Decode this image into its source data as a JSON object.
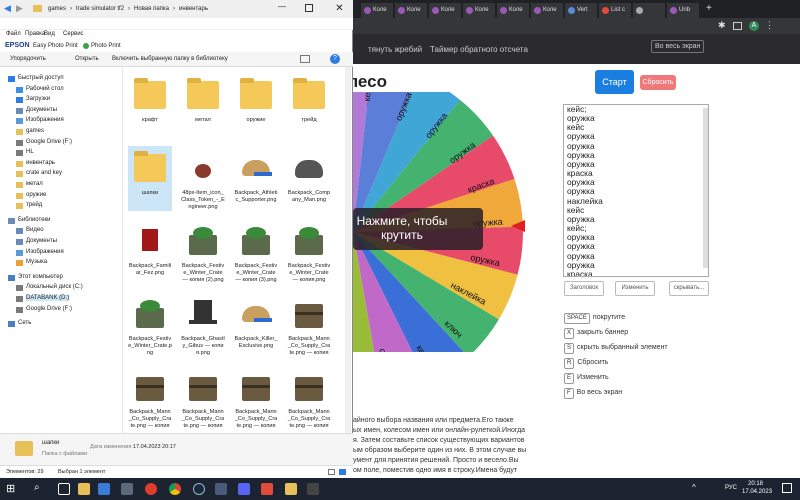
{
  "explorer": {
    "breadcrumb": [
      "games",
      "trade simulator tf2",
      "Новая папка",
      "инвентарь"
    ],
    "menu": [
      "Файл",
      "Правка",
      "Вид",
      "Сервис"
    ],
    "quick": {
      "brand": "EPSON",
      "app1": "Easy Photo Print",
      "app2": "Photo Print"
    },
    "toolbar": {
      "organize": "Упорядочить",
      "open": "Открыть",
      "include": "Включить выбранную папку в библиотеку"
    },
    "nav": [
      {
        "label": "Быстрый доступ",
        "indent": 0,
        "color": "#2d7be5"
      },
      {
        "label": "Рабочий стол",
        "indent": 1,
        "color": "#3d8ee6"
      },
      {
        "label": "Загрузки",
        "indent": 1,
        "color": "#2d7be5"
      },
      {
        "label": "Документы",
        "indent": 1,
        "color": "#6a8bb5"
      },
      {
        "label": "Изображения",
        "indent": 1,
        "color": "#5b9bd5"
      },
      {
        "label": "games",
        "indent": 1,
        "color": "#e8c05a"
      },
      {
        "label": "Google Drive (F:)",
        "indent": 1,
        "color": "#7a7a7a"
      },
      {
        "label": "HL",
        "indent": 1,
        "color": "#7a7a7a"
      },
      {
        "label": "инвентарь",
        "indent": 1,
        "color": "#e8c05a"
      },
      {
        "label": "crate and key",
        "indent": 1,
        "color": "#e8c05a"
      },
      {
        "label": "метал",
        "indent": 1,
        "color": "#e8c05a"
      },
      {
        "label": "оружие",
        "indent": 1,
        "color": "#e8c05a"
      },
      {
        "label": "трейд",
        "indent": 1,
        "color": "#e8c05a"
      },
      {
        "label": "Библиотеки",
        "indent": 0,
        "color": "#6a8bb5"
      },
      {
        "label": "Видео",
        "indent": 1,
        "color": "#6a8bb5"
      },
      {
        "label": "Документы",
        "indent": 1,
        "color": "#6a8bb5"
      },
      {
        "label": "Изображения",
        "indent": 1,
        "color": "#5b9bd5"
      },
      {
        "label": "Музыка",
        "indent": 1,
        "color": "#e8a03a"
      },
      {
        "label": "Этот компьютер",
        "indent": 0,
        "color": "#4a7fc4"
      },
      {
        "label": "Локальный диск (C:)",
        "indent": 1,
        "color": "#7a7a7a"
      },
      {
        "label": "DATABANK (D:)",
        "indent": 1,
        "color": "#7a7a7a"
      },
      {
        "label": "Google Drive (F:)",
        "indent": 1,
        "color": "#7a7a7a"
      },
      {
        "label": "Сеть",
        "indent": 0,
        "color": "#4a7fc4"
      }
    ],
    "files": [
      {
        "name": "крафт",
        "kind": "folder"
      },
      {
        "name": "метал",
        "kind": "folder"
      },
      {
        "name": "оружие",
        "kind": "folder"
      },
      {
        "name": "трейд",
        "kind": "folder"
      },
      {
        "name": "шапки",
        "kind": "folder"
      },
      {
        "name": "48px-Item_icon_Class_Token_-_Engineer.png",
        "kind": "token"
      },
      {
        "name": "Backpack_Athletic_Supporter.png",
        "kind": "cap"
      },
      {
        "name": "Backpack_Company_Man.png",
        "kind": "hat"
      },
      {
        "name": "Backpack_Familiar_Fez.png",
        "kind": "fez"
      },
      {
        "name": "Backpack_Festive_Winter_Crate — копия (2).png",
        "kind": "crate"
      },
      {
        "name": "Backpack_Festive_Winter_Crate — копия (3).png",
        "kind": "crate"
      },
      {
        "name": "Backpack_Festive_Winter_Crate — копия.png",
        "kind": "crate"
      },
      {
        "name": "Backpack_Festive_Winter_Crate.png",
        "kind": "crate"
      },
      {
        "name": "Backpack_Ghastly_Gibus — копия.png",
        "kind": "tophat"
      },
      {
        "name": "Backpack_Killer_Exclusive.png",
        "kind": "cap"
      },
      {
        "name": "Backpack_Mann_Co_Supply_Crate.png — копия — копия (2)",
        "kind": "box"
      },
      {
        "name": "Backpack_Mann_Co_Supply_Crate.png — копия — коп",
        "kind": "box"
      },
      {
        "name": "Backpack_Mann_Co_Supply_Crate.png — копия — коп",
        "kind": "box"
      },
      {
        "name": "Backpack_Mann_Co_Supply_Crate.png — копия — коп",
        "kind": "box"
      },
      {
        "name": "Backpack_Mann_Co_Supply_Crate.png — копия (2)",
        "kind": "box"
      }
    ],
    "details": {
      "name": "шапки",
      "date_label": "Дата изменения:",
      "date": "17.04.2023 20:17",
      "type": "Папка с файлами"
    },
    "status": {
      "count": "Элементов: 29",
      "selected": "Выбран 1 элемент"
    }
  },
  "browser": {
    "tabs": [
      {
        "label": "Коле",
        "color": "#9b59b6"
      },
      {
        "label": "Коле",
        "color": "#9b59b6"
      },
      {
        "label": "Коле",
        "color": "#9b59b6"
      },
      {
        "label": "Коле",
        "color": "#9b59b6"
      },
      {
        "label": "Коле",
        "color": "#9b59b6"
      },
      {
        "label": "Коле",
        "color": "#9b59b6"
      },
      {
        "label": "Vert",
        "color": "#5a8ad8"
      },
      {
        "label": "List c",
        "color": "#e24a3b"
      },
      {
        "label": "",
        "color": "#aaa"
      },
      {
        "label": "Unb",
        "color": "#9b59b6"
      }
    ],
    "toolbar_avatar": "A",
    "nav_links": [
      "тянуть жребий",
      "Таймер обратного отсчета"
    ],
    "fullscreen_btn": "Во весь экран",
    "title": "Колесо фортуны",
    "start": "Старт",
    "reset": "Сбросить",
    "wheel_center": "Нажмите, чтобы крутить",
    "wheel_labels": [
      {
        "text": "кейс",
        "deg": 84
      },
      {
        "text": "оружка",
        "deg": 68
      },
      {
        "text": "оружка",
        "deg": 52
      },
      {
        "text": "оружка",
        "deg": 36
      },
      {
        "text": "краска",
        "deg": 20
      },
      {
        "text": "оружка",
        "deg": 4
      },
      {
        "text": "оружка",
        "deg": -12
      },
      {
        "text": "наклейка",
        "deg": -28
      },
      {
        "text": "ключ",
        "deg": -44
      },
      {
        "text": "кейс",
        "deg": -60
      },
      {
        "text": "оружка",
        "deg": -76
      },
      {
        "text": "кейс",
        "deg": 100
      },
      {
        "text": "оружка",
        "deg": 116
      }
    ],
    "list_items": [
      "кейс;",
      "оружка",
      "кейс",
      "оружка",
      "оружка",
      "оружка",
      "оружка",
      "краска",
      "оружка",
      "оружка",
      "наклейка",
      "кейс",
      "оружка",
      "кейс;",
      "оружка",
      "оружка",
      "оружка",
      "оружка",
      "краска"
    ],
    "side_buttons": {
      "save": "Заголовок",
      "change": "Изменить",
      "hide": "скрывать..."
    },
    "shortcuts": [
      {
        "key": "SPACE",
        "label": "покрутите"
      },
      {
        "key": "X",
        "label": "закрыть баннер"
      },
      {
        "key": "S",
        "label": "скрыть выбранный элемент"
      },
      {
        "key": "R",
        "label": "Сбросить"
      },
      {
        "key": "E",
        "label": "Изменить"
      },
      {
        "key": "F",
        "label": "Во весь экран"
      }
    ],
    "description": [
      "айного выбора названия или предмета.Его также",
      "ых имен, колесом имен или онлайн-рулеткой.Иногда",
      "я. Затем составьте список существующих вариантов",
      "ым образом выберите один из них. В этом случае вы",
      "умент для принятия решений. Просто и весело.Вы",
      "ом поле, поместив одно имя в строку.Имена будут"
    ]
  },
  "taskbar": {
    "lang": "РУС",
    "time": "20:18",
    "date": "17.04.2023"
  }
}
